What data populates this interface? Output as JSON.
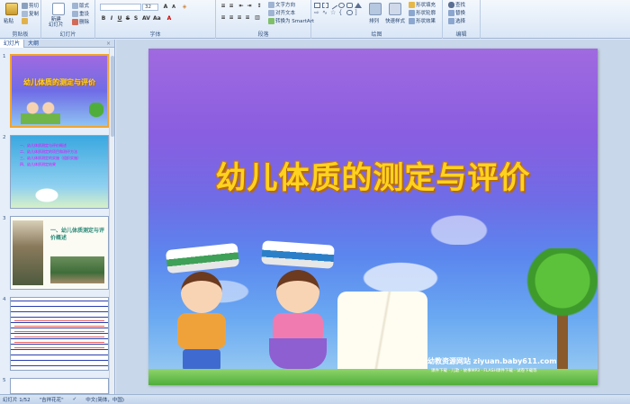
{
  "ribbon": {
    "clipboard": {
      "label": "剪贴板",
      "paste": "粘贴",
      "cut": "剪切",
      "copy": "复制",
      "format_painter": "格式刷"
    },
    "slides": {
      "label": "幻灯片",
      "new_slide": "新建\n幻灯片",
      "layout": "版式",
      "reset": "重设",
      "delete": "删除"
    },
    "font": {
      "label": "字体",
      "font_name": "",
      "font_size": "32"
    },
    "paragraph": {
      "label": "段落",
      "text_direction": "文字方向",
      "align_text": "对齐文本",
      "convert_smartart": "转换为 SmartArt"
    },
    "drawing": {
      "label": "绘图",
      "arrange": "排列",
      "quick_styles": "快速样式",
      "shape_fill": "形状填充",
      "shape_outline": "形状轮廓",
      "shape_effects": "形状效果"
    },
    "editing": {
      "label": "编辑",
      "find": "查找",
      "replace": "替换",
      "select": "选择"
    }
  },
  "left_pane": {
    "tab_slides": "幻灯片",
    "tab_outline": "大纲",
    "close": "×",
    "thumbnails": [
      {
        "number": "1",
        "title": "幼儿体质的测定与评价"
      },
      {
        "number": "2",
        "lines": [
          "一、幼儿体质测定与评价概述",
          "二、幼儿体质测定的项目和测评方法",
          "三、幼儿体质测定的实施（组织实施）",
          "四、幼儿体质测定结果"
        ]
      },
      {
        "number": "3",
        "heading": "一、幼儿体质测定与评价概述"
      },
      {
        "number": "4"
      },
      {
        "number": "5"
      }
    ]
  },
  "slide": {
    "title": "幼儿体质的测定与评价",
    "watermark": "幼教资源网站  ziyuan.baby611.com",
    "watermark_sub": "课件下载 · 儿歌 · 故事MP3 · FLASH课件下载 · 试卷下载等"
  },
  "status_bar": {
    "slide_counter": "幻灯片 1/52",
    "theme": "\"吉祥花花\"",
    "language": "中文(简体，中国)"
  },
  "colors": {
    "ribbon_bg": "#dbe7f6",
    "slide_bg_top": "#a06ae0",
    "slide_bg_bottom": "#9fd0f2",
    "title_color": "#ffd21e",
    "selected_thumb_border": "#f3a42f"
  }
}
